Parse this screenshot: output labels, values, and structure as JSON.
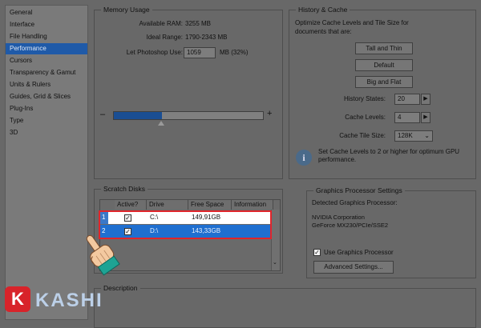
{
  "nav": {
    "items": [
      "General",
      "Interface",
      "File Handling",
      "Performance",
      "Cursors",
      "Transparency & Gamut",
      "Units & Rulers",
      "Guides, Grid & Slices",
      "Plug-Ins",
      "Type",
      "3D"
    ],
    "selected_index": 3
  },
  "memory": {
    "title": "Memory Usage",
    "available_label": "Available RAM:",
    "available_value": "3255 MB",
    "ideal_label": "Ideal Range:",
    "ideal_value": "1790-2343 MB",
    "let_label": "Let Photoshop Use:",
    "let_value": "1059",
    "let_unit": "MB (32%)",
    "minus": "–",
    "plus": "+",
    "slider_fraction": 0.32
  },
  "history": {
    "title": "History & Cache",
    "desc": "Optimize Cache Levels and Tile Size for documents that are:",
    "btn_tall": "Tall and Thin",
    "btn_default": "Default",
    "btn_big": "Big and Flat",
    "states_label": "History States:",
    "states_value": "20",
    "levels_label": "Cache Levels:",
    "levels_value": "4",
    "tile_label": "Cache Tile Size:",
    "tile_value": "128K",
    "info_text": "Set Cache Levels to 2 or higher for optimum GPU performance."
  },
  "scratch": {
    "title": "Scratch Disks",
    "headers": [
      "Active?",
      "Drive",
      "Free Space",
      "Information"
    ],
    "rows": [
      {
        "num": "1",
        "active": true,
        "drive": "C:\\",
        "free": "149,91GB"
      },
      {
        "num": "2",
        "active": true,
        "drive": "D:\\",
        "free": "143,33GB"
      }
    ]
  },
  "gpu": {
    "title": "Graphics Processor Settings",
    "detected_label": "Detected Graphics Processor:",
    "line1": "NVIDIA Corporation",
    "line2": "GeForce MX230/PCIe/SSE2",
    "use_label": "Use Graphics Processor",
    "use_checked": true,
    "advanced_btn": "Advanced Settings..."
  },
  "description": {
    "title": "Description"
  },
  "watermark": {
    "badge": "K",
    "text": "KASHI"
  },
  "colors": {
    "highlight": "#1f5aa8",
    "annotation": "#e0252b"
  }
}
